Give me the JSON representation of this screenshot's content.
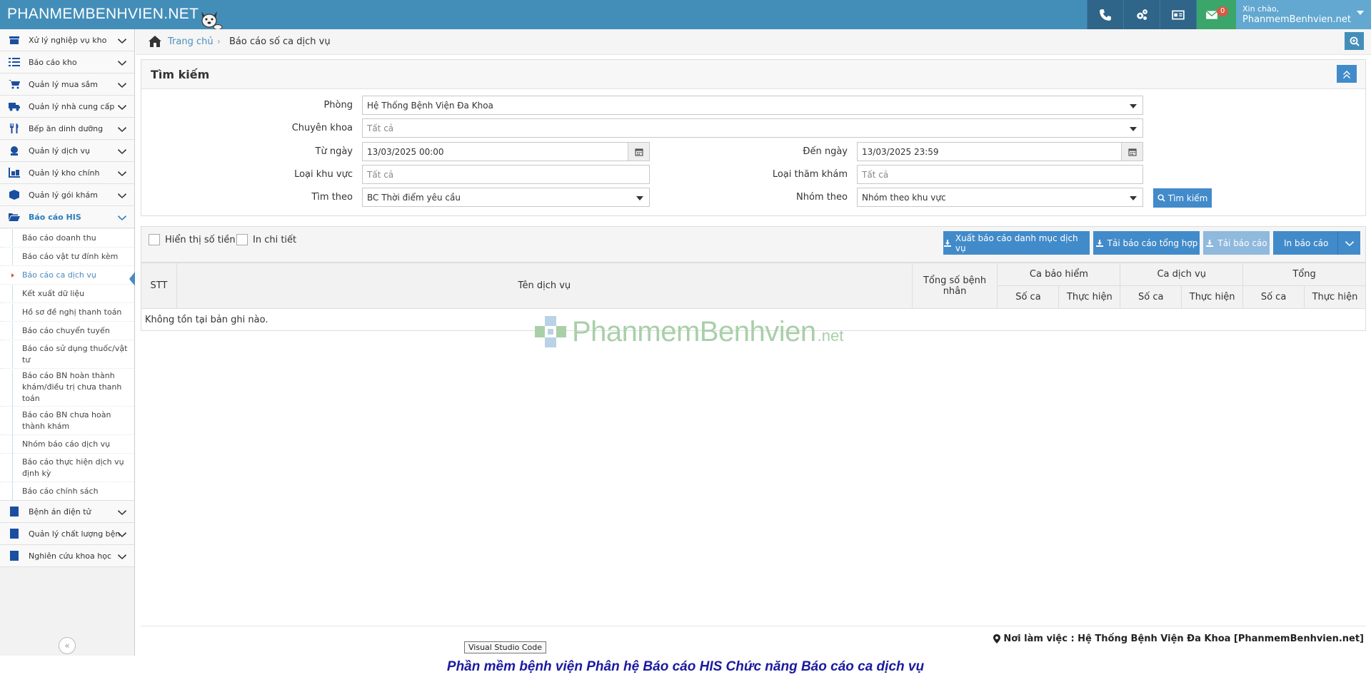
{
  "navbar": {
    "brand": "PHANMEMBENHVIEN.NET",
    "notification_count": "0",
    "greeting": "Xin chào,",
    "username": "PhanmemBenhvien.net"
  },
  "sidebar": {
    "items_top": [
      {
        "label": "Xử lý nghiệp vụ kho",
        "icon": "store-icon"
      },
      {
        "label": "Báo cáo kho",
        "icon": "list-icon"
      },
      {
        "label": "Quản lý mua sắm",
        "icon": "cart-icon"
      },
      {
        "label": "Quản lý nhà cung cấp",
        "icon": "truck-icon"
      },
      {
        "label": "Bếp ăn dinh dưỡng",
        "icon": "cutlery-icon"
      },
      {
        "label": "Quản lý dịch vụ",
        "icon": "service-icon"
      },
      {
        "label": "Quản lý kho chính",
        "icon": "warehouse-icon"
      },
      {
        "label": "Quản lý gói khám",
        "icon": "package-icon"
      }
    ],
    "open_item": {
      "label": "Báo cáo HIS",
      "icon": "folder-open-icon"
    },
    "submenu": [
      "Báo cáo doanh thu",
      "Báo cáo vật tư đính kèm",
      "Báo cáo ca dịch vụ",
      "Kết xuất dữ liệu",
      "Hồ sơ đề nghị thanh toán",
      "Báo cáo chuyển tuyến",
      "Báo cáo sử dụng thuốc/vật tư",
      "Báo cáo BN hoàn thành khám/điều trị chưa thanh toán",
      "Báo cáo BN chưa hoàn thành khám",
      "Nhóm báo cáo dịch vụ",
      "Báo cáo thực hiện dịch vụ định kỳ",
      "Báo cáo chính sách"
    ],
    "active_sub_index": 2,
    "items_bottom": [
      {
        "label": "Bệnh án điện tử",
        "icon": "record-icon"
      },
      {
        "label": "Quản lý chất lượng bệnh",
        "icon": "quality-icon"
      },
      {
        "label": "Nghiên cứu khoa học",
        "icon": "research-icon"
      }
    ]
  },
  "breadcrumb": {
    "home": "Trang chủ",
    "current": "Báo cáo số ca dịch vụ"
  },
  "search": {
    "title": "Tìm kiếm",
    "phong_label": "Phòng",
    "phong_value": "Hệ Thống Bệnh Viện Đa Khoa",
    "chuyenkhoa_label": "Chuyên khoa",
    "chuyenkhoa_placeholder": "Tất cả",
    "tungay_label": "Từ ngày",
    "tungay_value": "13/03/2025 00:00",
    "denngay_label": "Đến ngày",
    "denngay_value": "13/03/2025 23:59",
    "loaikhuvuc_label": "Loại khu vực",
    "loaikhuvuc_placeholder": "Tất cả",
    "loaithamkham_label": "Loại thăm khám",
    "loaithamkham_placeholder": "Tất cả",
    "timtheo_label": "Tìm theo",
    "timtheo_value": "BC Thời điểm yêu cầu",
    "nhomtheo_label": "Nhóm theo",
    "nhomtheo_value": "Nhóm theo khu vực",
    "button": "Tìm kiếm"
  },
  "toolbar": {
    "show_money": "Hiển thị số tiền",
    "print_detail": "In chi tiết",
    "export_button": "Xuất báo cáo danh mục dịch vụ",
    "download_summary": "Tải báo cáo tổng hợp",
    "download_report": "Tải báo cáo",
    "print_report": "In báo cáo"
  },
  "table": {
    "stt": "STT",
    "ten_dich_vu": "Tên dịch vụ",
    "tong_so_benh_nhan": "Tổng số bệnh nhân",
    "ca_bao_hiem": "Ca bảo hiểm",
    "ca_dich_vu": "Ca dịch vụ",
    "tong": "Tổng",
    "so_ca": "Số ca",
    "thuc_hien": "Thực hiện",
    "empty": "Không tồn tại bản ghi nào."
  },
  "watermark": {
    "text": "PhanmemBenhvien",
    "suffix": ".net"
  },
  "footer": {
    "location": "Nơi làm việc : Hệ Thống Bệnh Viện Đa Khoa [PhanmemBenhvien.net]"
  },
  "tooltip": "Visual Studio Code",
  "caption": "Phần mềm bệnh viện Phân hệ Báo cáo HIS Chức năng Báo cáo ca dịch vụ"
}
